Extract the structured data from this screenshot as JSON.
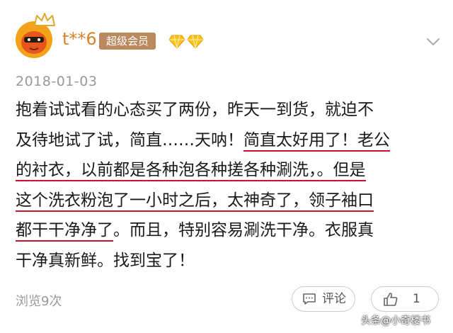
{
  "user": {
    "name": "t**6",
    "badge": "超级会员"
  },
  "post": {
    "date": "2018-01-03",
    "lines": [
      {
        "a": "抱着试试看的心态买了两份，昨天一到货，就迫不",
        "hl": "",
        "b": ""
      },
      {
        "a": "及待地试了试，简直……天呐！",
        "hl": "简直太好用了！老公",
        "b": ""
      },
      {
        "a": "",
        "hl": "的衬衣，以前都是各种泡各种搓各种涮洗，。但是",
        "b": ""
      },
      {
        "a": "",
        "hl": "这个洗衣粉泡了一小时之后，太神奇了，领子袖口",
        "b": ""
      },
      {
        "a": "",
        "hl": "都干干净净了",
        "b": "。而且，特别容易涮洗干净。衣服真"
      },
      {
        "a": "干净真新鲜。找到宝了！",
        "hl": "",
        "b": ""
      }
    ]
  },
  "footer": {
    "views": "浏览9次",
    "comment_label": "评论",
    "like_count": "1"
  },
  "watermark": "头条@小奇楼书",
  "colors": {
    "username": "#d9822b",
    "badge_bg": "#b98a5e",
    "underline": "#c8102e"
  }
}
